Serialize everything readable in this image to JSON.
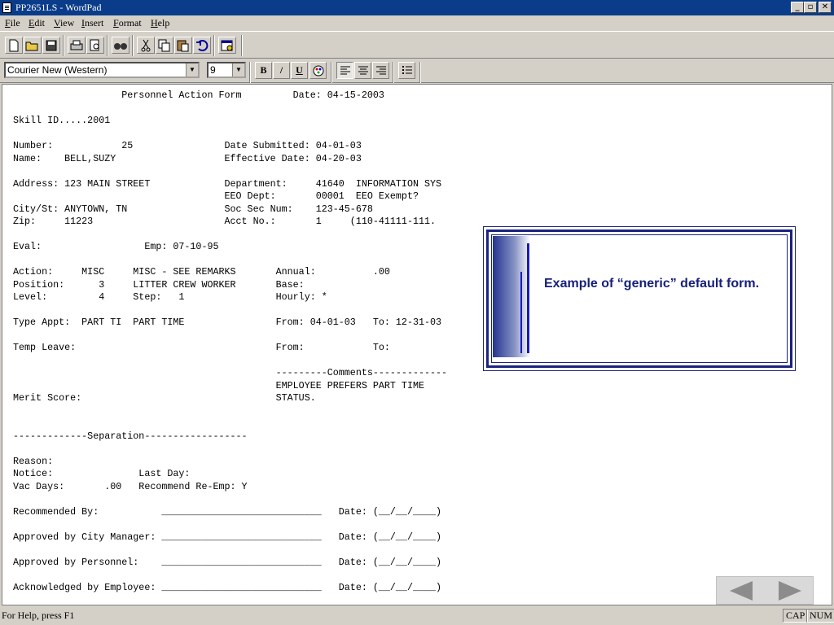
{
  "window": {
    "title": "PP2651LS - WordPad",
    "minimize_label": "_",
    "restore_label": "▫",
    "close_label": "✕"
  },
  "menu": {
    "items": [
      "File",
      "Edit",
      "View",
      "Insert",
      "Format",
      "Help"
    ]
  },
  "toolbar": {
    "buttons": [
      "new-icon",
      "open-icon",
      "save-icon",
      "print-icon",
      "print-preview-icon",
      "find-icon",
      "cut-icon",
      "copy-icon",
      "paste-icon",
      "undo-icon",
      "insert-date-icon"
    ]
  },
  "format_bar": {
    "font": "Courier New (Western)",
    "size": "9",
    "bold": "B",
    "italic": "/",
    "underline": "U"
  },
  "document": {
    "text": "                   Personnel Action Form         Date: 04-15-2003\n\nSkill ID.....2001\n\nNumber:            25                Date Submitted: 04-01-03\nName:    BELL,SUZY                   Effective Date: 04-20-03\n\nAddress: 123 MAIN STREET             Department:     41640  INFORMATION SYS\n                                     EEO Dept:       00001  EEO Exempt?\nCity/St: ANYTOWN, TN                 Soc Sec Num:    123-45-678\nZip:     11223                       Acct No.:       1     (110-41111-111.\n\nEval:                  Emp: 07-10-95\n\nAction:     MISC     MISC - SEE REMARKS       Annual:          .00\nPosition:      3     LITTER CREW WORKER       Base:\nLevel:         4     Step:   1                Hourly: *\n\nType Appt:  PART TI  PART TIME                From: 04-01-03   To: 12-31-03\n\nTemp Leave:                                   From:            To:\n\n                                              ---------Comments-------------\n                                              EMPLOYEE PREFERS PART TIME\nMerit Score:                                  STATUS.\n\n\n-------------Separation------------------\n\nReason:\nNotice:               Last Day:\nVac Days:       .00   Recommend Re-Emp: Y\n\nRecommended By:           ____________________________   Date: (__/__/____)\n\nApproved by City Manager: ____________________________   Date: (__/__/____)\n\nApproved by Personnel:    ____________________________   Date: (__/__/____)\n\nAcknowledged by Employee: ____________________________   Date: (__/__/____)"
  },
  "callout": {
    "text": "Example of “generic” default form."
  },
  "status": {
    "help": "For Help, press F1",
    "cap": "CAP",
    "num": "NUM"
  },
  "nav": {
    "prev": "previous-slide-icon",
    "next": "next-slide-icon"
  }
}
